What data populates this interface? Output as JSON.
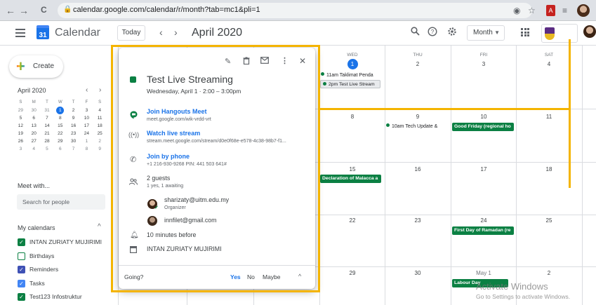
{
  "browser": {
    "back": "←",
    "forward": "→",
    "reload": "C",
    "url": "calendar.google.com/calendar/r/month?tab=mc1&pli=1"
  },
  "header": {
    "app_title": "Calendar",
    "logo_day": "31",
    "today_label": "Today",
    "prev": "‹",
    "next": "›",
    "month_title": "April 2020",
    "view_label": "Month"
  },
  "sidebar": {
    "create_label": "Create",
    "mini_month": "April 2020",
    "mini_weekdays": [
      "S",
      "M",
      "T",
      "W",
      "T",
      "F",
      "S"
    ],
    "mini_weeks": [
      [
        "29",
        "30",
        "31",
        "1",
        "2",
        "3",
        "4"
      ],
      [
        "5",
        "6",
        "7",
        "8",
        "9",
        "10",
        "11"
      ],
      [
        "12",
        "13",
        "14",
        "15",
        "16",
        "17",
        "18"
      ],
      [
        "19",
        "20",
        "21",
        "22",
        "23",
        "24",
        "25"
      ],
      [
        "26",
        "27",
        "28",
        "29",
        "30",
        "1",
        "2"
      ],
      [
        "3",
        "4",
        "5",
        "6",
        "7",
        "8",
        "9"
      ]
    ],
    "meet_title": "Meet with...",
    "search_people_placeholder": "Search for people",
    "my_calendars_title": "My calendars",
    "calendars": [
      {
        "name": "INTAN ZURIATY MUJIRIMI",
        "checked": true,
        "color": "#0b8043"
      },
      {
        "name": "Birthdays",
        "checked": false,
        "color": "#0b8043"
      },
      {
        "name": "Reminders",
        "checked": true,
        "color": "#3f51b5"
      },
      {
        "name": "Tasks",
        "checked": true,
        "color": "#4285f4"
      },
      {
        "name": "Test123 Infostruktur",
        "checked": true,
        "color": "#0b8043"
      }
    ]
  },
  "grid": {
    "columns": [
      {
        "day": "",
        "date": ""
      },
      {
        "day": "",
        "date": ""
      },
      {
        "day": "",
        "date": ""
      },
      {
        "day": "WED",
        "date": "1"
      },
      {
        "day": "THU",
        "date": "2"
      },
      {
        "day": "FRI",
        "date": "3"
      },
      {
        "day": "SAT",
        "date": "4"
      }
    ],
    "week2": [
      "8",
      "9",
      "10",
      "11"
    ],
    "week3": [
      "15",
      "16",
      "17",
      "18"
    ],
    "week4": [
      "22",
      "23",
      "24",
      "25"
    ],
    "week5": [
      "29",
      "30",
      "May 1",
      "2"
    ],
    "events": {
      "taklimat": "11am Taklimat Penda",
      "live_stream": "2pm Test Live Stream",
      "tech_update": "10am Tech Update &",
      "good_friday": "Good Friday (regional ho",
      "malacca": "Declaration of Malacca a",
      "ramadan": "First Day of Ramadan (re",
      "labour_day": "Labour Day"
    }
  },
  "popup": {
    "title": "Test Live Streaming",
    "when": "Wednesday, April 1  ·  2:00 – 3:00pm",
    "hangouts_link": "Join Hangouts Meet",
    "hangouts_url": "meet.google.com/wik-vrdd-vrt",
    "stream_link": "Watch live stream",
    "stream_url": "stream.meet.google.com/stream/d0e0f68e-e578-4c38-98b7-f1...",
    "phone_link": "Join by phone",
    "phone_detail": "+1 216-930-9268 PIN: 441 503 641#",
    "guests_title": "2 guests",
    "guests_detail": "1 yes, 1 awaiting",
    "guest1_email": "sharizaty@uitm.edu.my",
    "guest1_role": "Organizer",
    "guest2_email": "innfilet@gmail.com",
    "reminder": "10 minutes before",
    "calendar_owner": "INTAN ZURIATY MUJIRIMI",
    "going_label": "Going?",
    "yes": "Yes",
    "no": "No",
    "maybe": "Maybe"
  },
  "watermark": {
    "line1": "Activate Windows",
    "line2": "Go to Settings to activate Windows."
  },
  "colors": {
    "accent": "#1a73e8",
    "event_green": "#0b8043",
    "highlight": "#f4b400"
  }
}
